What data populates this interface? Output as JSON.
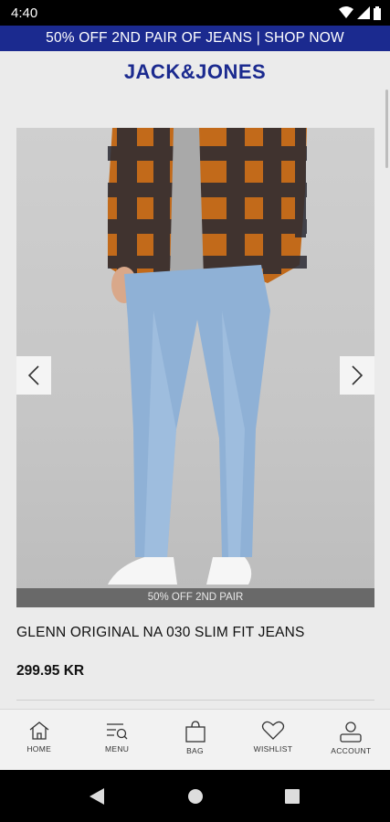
{
  "status_bar": {
    "time": "4:40"
  },
  "promo_banner": {
    "text": "50% OFF 2ND PAIR OF JEANS | SHOP NOW"
  },
  "brand": {
    "logo_text": "JACK&JONES",
    "color": "#1b2a8f"
  },
  "product": {
    "image_caption": "50% OFF 2ND PAIR",
    "title": "GLENN ORIGINAL NA 030 SLIM FIT JEANS",
    "price": "299.95 KR"
  },
  "carousel": {
    "prev_icon": "chevron-left-icon",
    "next_icon": "chevron-right-icon"
  },
  "bottom_nav": {
    "items": [
      {
        "label": "HOME",
        "icon": "home-icon"
      },
      {
        "label": "MENU",
        "icon": "menu-search-icon"
      },
      {
        "label": "BAG",
        "icon": "bag-icon"
      },
      {
        "label": "WISHLIST",
        "icon": "heart-icon"
      },
      {
        "label": "ACCOUNT",
        "icon": "user-icon"
      }
    ]
  },
  "android_nav": {
    "buttons": [
      "back-icon",
      "home-circle-icon",
      "recents-icon"
    ]
  }
}
